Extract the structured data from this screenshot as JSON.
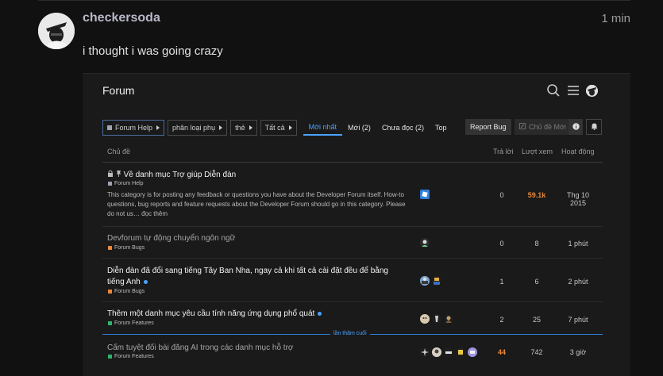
{
  "post": {
    "username": "checkersoda",
    "time": "1 min",
    "body": "i thought i was going crazy"
  },
  "forum": {
    "title": "Forum",
    "breadcrumbs": [
      {
        "label": "Forum Help"
      },
      {
        "label": "phân loại phụ"
      },
      {
        "label": "thẻ"
      },
      {
        "label": "Tất cả"
      }
    ],
    "tabs": [
      {
        "label": "Mới nhất",
        "active": true
      },
      {
        "label": "Mới (2)"
      },
      {
        "label": "Chưa đọc (2)"
      },
      {
        "label": "Top"
      }
    ],
    "buttons": {
      "report_bug": "Report Bug",
      "new_topic": "Chủ đề Mới"
    },
    "columns": {
      "topic": "Chủ đề",
      "replies": "Trả lời",
      "views": "Lượt xem",
      "activity": "Hoạt động"
    },
    "last_visit_label": "lần thăm cuối",
    "topics": [
      {
        "title": "Về danh mục Trợ giúp Diễn đàn",
        "category": "Forum Help",
        "category_color": "#9ea4b0",
        "excerpt": "This category is for posting any feedback or questions you have about the Developer Forum itself. How-to questions, bug reports and feature requests about the Developer Forum should go in this category. Please do not us… đọc thêm",
        "replies": "0",
        "views": "59.1k",
        "activity": "Thg 10 2015"
      },
      {
        "title": "Devforum tự động chuyển ngôn ngữ",
        "category": "Forum Bugs",
        "category_color": "#e8883a",
        "replies": "0",
        "views": "8",
        "activity": "1 phút"
      },
      {
        "title": "Diễn đàn đã đổi sang tiếng Tây Ban Nha, ngay cả khi tất cả cài đặt đều để bằng tiếng Anh",
        "category": "Forum Bugs",
        "category_color": "#e8883a",
        "replies": "1",
        "views": "6",
        "activity": "2 phút"
      },
      {
        "title": "Thêm một danh mục yêu cầu tính năng ứng dụng phổ quát",
        "category": "Forum Features",
        "category_color": "#2fb36b",
        "replies": "2",
        "views": "25",
        "activity": "7 phút"
      },
      {
        "title": "Cấm tuyệt đối bài đăng AI trong các danh mục hỗ trợ",
        "category": "Forum Features",
        "category_color": "#2fb36b",
        "replies": "44",
        "views": "742",
        "activity": "3 giờ"
      }
    ]
  }
}
